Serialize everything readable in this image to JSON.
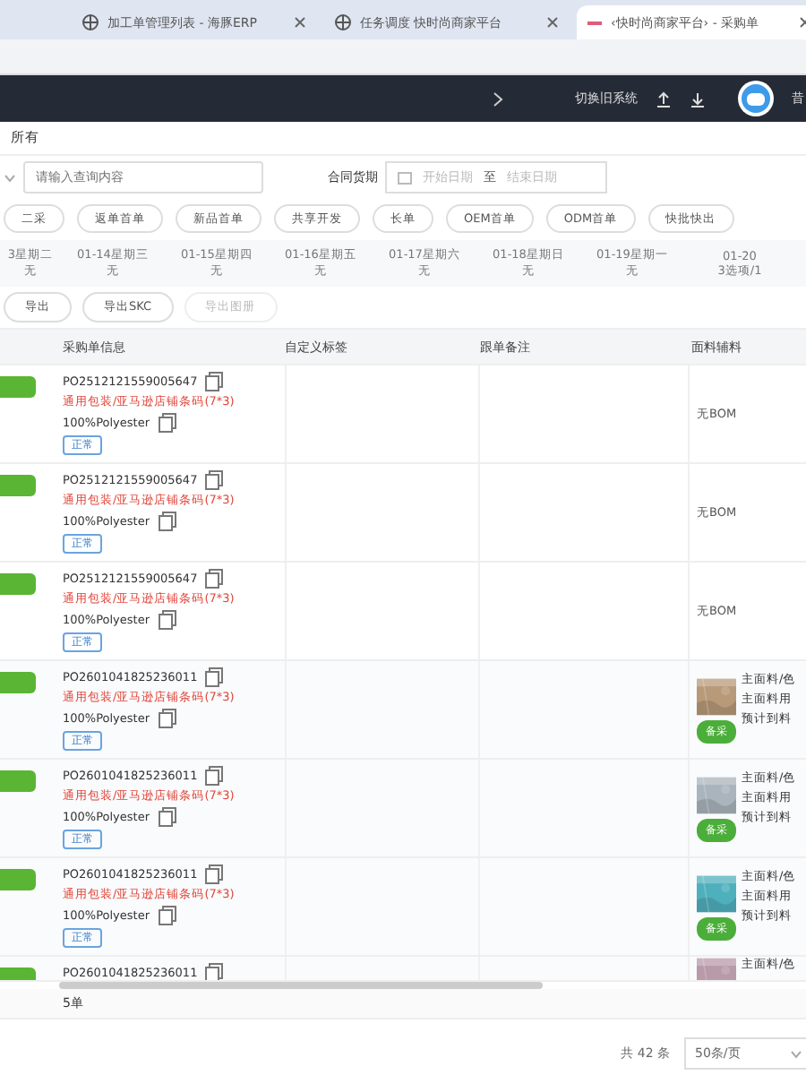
{
  "browser_tabs": [
    {
      "title": "加工单管理列表 - 海豚ERP",
      "selected": false
    },
    {
      "title": "任务调度 快时尚商家平台",
      "selected": false
    },
    {
      "title": "‹快时尚商家平台› - 采购单",
      "selected": true
    }
  ],
  "header": {
    "switch_label": "切换旧系统",
    "user": "昔"
  },
  "scope": "所有",
  "search": {
    "placeholder": "请输入查询内容"
  },
  "date_filter": {
    "label": "合同货期",
    "start_placeholder": "开始日期",
    "separator": "至",
    "end_placeholder": "结束日期"
  },
  "chips": [
    {
      "label": "二采",
      "selected": false
    },
    {
      "label": "返单首单",
      "selected": false
    },
    {
      "label": "新品首单",
      "selected": false
    },
    {
      "label": "共享开发",
      "selected": false
    },
    {
      "label": "长单",
      "selected": false
    },
    {
      "label": "OEM首单",
      "selected": false
    },
    {
      "label": "ODM首单",
      "selected": false
    },
    {
      "label": "快批快出",
      "selected": false
    }
  ],
  "days": [
    {
      "date": "3星期二",
      "count": "无"
    },
    {
      "date": "01-14星期三",
      "count": "无"
    },
    {
      "date": "01-15星期四",
      "count": "无"
    },
    {
      "date": "01-16星期五",
      "count": "无"
    },
    {
      "date": "01-17星期六",
      "count": "无"
    },
    {
      "date": "01-18星期日",
      "count": "无"
    },
    {
      "date": "01-19星期一",
      "count": "无"
    },
    {
      "date": "01-20",
      "count": "3选项/1"
    }
  ],
  "actions": [
    {
      "label": "导出",
      "disabled": false
    },
    {
      "label": "导出SKC",
      "disabled": false
    },
    {
      "label": "导出图册",
      "disabled": true
    }
  ],
  "table": {
    "columns": [
      "采购单信息",
      "自定义标签",
      "跟单备注",
      "面料辅料"
    ],
    "rows": [
      {
        "po": "PO2512121559005647",
        "packaging": "通用包装/亚马逊店铺条码(7*3)",
        "composition": "100%Polyester",
        "tag": "正常",
        "material": {
          "kind": "text",
          "text": "无BOM"
        }
      },
      {
        "po": "PO2512121559005647",
        "packaging": "通用包装/亚马逊店铺条码(7*3)",
        "composition": "100%Polyester",
        "tag": "正常",
        "material": {
          "kind": "text",
          "text": "无BOM"
        }
      },
      {
        "po": "PO2512121559005647",
        "packaging": "通用包装/亚马逊店铺条码(7*3)",
        "composition": "100%Polyester",
        "tag": "正常",
        "material": {
          "kind": "text",
          "text": "无BOM"
        }
      },
      {
        "po": "PO2601041825236011",
        "packaging": "通用包装/亚马逊店铺条码(7*3)",
        "composition": "100%Polyester",
        "tag": "正常",
        "material": {
          "kind": "fabric",
          "color": "#b89a78",
          "lines": [
            "主面料/色",
            "主面料用",
            "预计到料"
          ],
          "button": "备采"
        }
      },
      {
        "po": "PO2601041825236011",
        "packaging": "通用包装/亚马逊店铺条码(7*3)",
        "composition": "100%Polyester",
        "tag": "正常",
        "material": {
          "kind": "fabric",
          "color": "#aab4bc",
          "lines": [
            "主面料/色",
            "主面料用",
            "预计到料"
          ],
          "button": "备采"
        }
      },
      {
        "po": "PO2601041825236011",
        "packaging": "通用包装/亚马逊店铺条码(7*3)",
        "composition": "100%Polyester",
        "tag": "正常",
        "material": {
          "kind": "fabric",
          "color": "#4fb0bd",
          "lines": [
            "主面料/色",
            "主面料用",
            "预计到料"
          ],
          "button": "备采"
        }
      },
      {
        "po": "PO2601041825236011",
        "material": {
          "kind": "fabric",
          "color": "#b89aa8",
          "lines": [
            "主面料/色"
          ]
        }
      }
    ],
    "summary": "5单"
  },
  "pagination": {
    "total": "共 42 条",
    "page_size": "50条/页"
  }
}
